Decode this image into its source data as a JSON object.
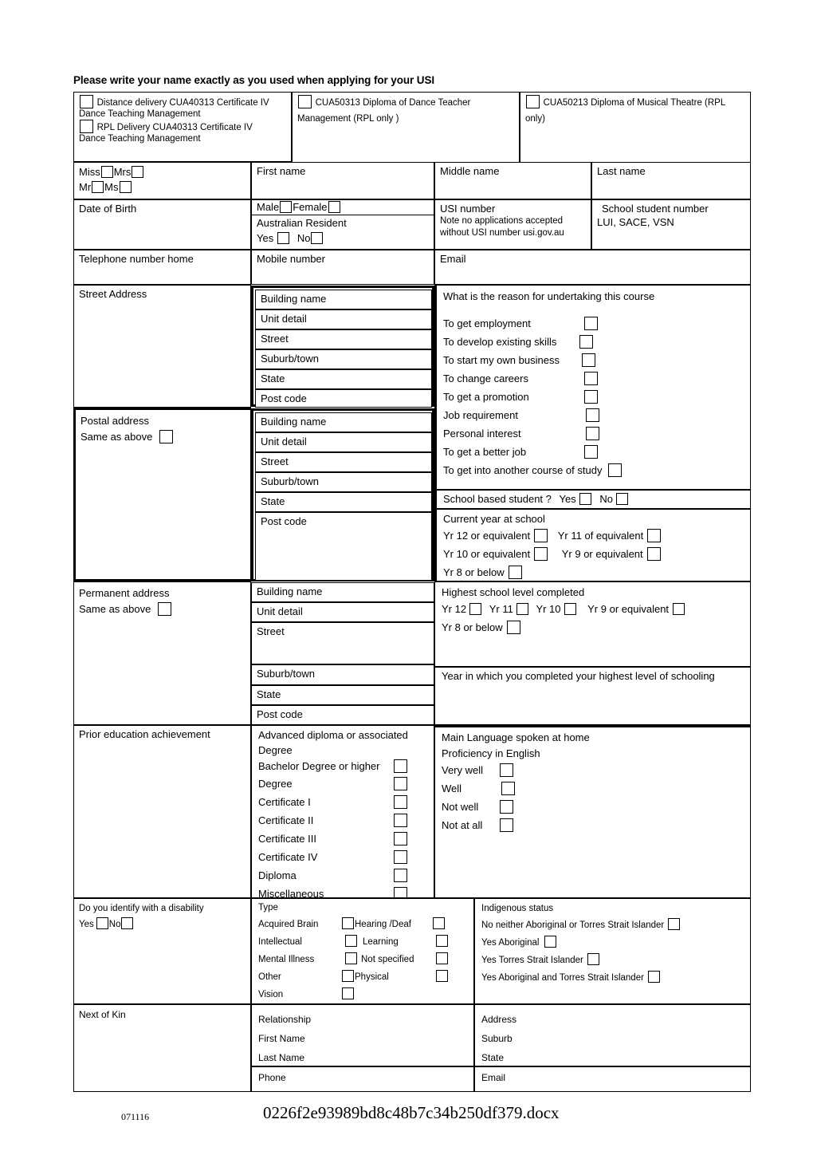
{
  "title": "Please write your name exactly as you used when applying for your USI",
  "courses": [
    {
      "id": "distance",
      "line1": "Distance delivery CUA40313 Certificate IV",
      "line2": "Dance Teaching Management"
    },
    {
      "id": "rpl",
      "line1": "RPL Delivery CUA40313 Certificate IV",
      "line2": "Dance Teaching Management"
    },
    {
      "id": "dance_teacher",
      "line1": "CUA50313 Diploma of Dance Teacher",
      "line2": "Management (RPL only )"
    },
    {
      "id": "musical_theatre",
      "line1": "CUA50213 Diploma of Musical Theatre  (RPL",
      "line2": "only)"
    }
  ],
  "titles": [
    "Miss",
    "Mrs",
    "Mr",
    "Ms"
  ],
  "name_fields": {
    "first": "First name",
    "middle": "Middle name",
    "last": "Last name"
  },
  "dob_label": "Date of Birth",
  "gender": {
    "male": "Male",
    "female": "Female"
  },
  "residency": {
    "label": "Australian Resident",
    "yes": "Yes",
    "no": "No"
  },
  "usi": {
    "label": "USI number",
    "note_line1": "Note no applications accepted",
    "note_line2": "without USI number usi.gov.au"
  },
  "school_student": {
    "line1": "School student number",
    "line2": "LUI, SACE, VSN"
  },
  "contact": {
    "telephone": "Telephone number home",
    "mobile": "Mobile number",
    "email": "Email"
  },
  "street_address": {
    "label": "Street Address",
    "fields": [
      "Building name",
      "Unit detail",
      "Street",
      "Suburb/town",
      "State",
      "Post code"
    ]
  },
  "postal_address": {
    "label": "Postal address",
    "same_as_above": "Same as above",
    "fields": [
      "Building name",
      "Unit detail",
      "Street",
      "Suburb/town",
      "State",
      "Post code"
    ]
  },
  "permanent_address": {
    "label": "Permanent address",
    "same_as_above": "Same as above",
    "fields": [
      "Building name",
      "Unit detail",
      "Street",
      "Suburb/town",
      "State",
      "Post code"
    ]
  },
  "reason": {
    "heading": "What is the reason for undertaking this course",
    "options": [
      "To get employment",
      "To develop existing skills",
      "To start my own business",
      "To change careers",
      "To get a promotion",
      "Job requirement",
      "Personal interest",
      "To get a better job",
      "To get into another course of study"
    ]
  },
  "school_based": {
    "label": "School based student ?",
    "yes": "Yes",
    "no": "No"
  },
  "current_year": {
    "heading": "Current year at school",
    "options": [
      "Yr 12 or equivalent",
      "Yr 11 of equivalent",
      "Yr 10 or equivalent",
      "Yr 9 or equivalent",
      "Yr 8 or below"
    ]
  },
  "highest_school": {
    "heading": "Highest school level completed",
    "options": [
      "Yr 12",
      "Yr 11",
      "Yr 10",
      "Yr 9 or equivalent",
      "Yr 8 or below"
    ]
  },
  "year_completed": "Year in which you completed your highest level of schooling",
  "prior_education": {
    "label": "Prior education achievement",
    "header_line1": "Advanced  diploma or associated",
    "header_line2": "Degree",
    "options": [
      "Bachelor Degree or higher",
      "Degree",
      "Certificate I",
      "Certificate II",
      "Certificate III",
      "Certificate IV",
      "Diploma",
      "Miscellaneous"
    ]
  },
  "language": {
    "heading1": "Main Language spoken at home",
    "heading2": "Proficiency in English",
    "options": [
      "Very well",
      "Well",
      "Not well",
      "Not at all"
    ]
  },
  "disability": {
    "question": "Do you identify with a disability",
    "yes": "Yes",
    "no": "No",
    "type_heading": "Type",
    "left_options": [
      "Acquired Brain",
      "Intellectual",
      "Mental Illness",
      "Other",
      "Vision"
    ],
    "right_options": [
      "Hearing /Deaf",
      "Learning",
      "Not specified",
      "Physical"
    ]
  },
  "indigenous": {
    "heading": "Indigenous status",
    "options": [
      "No neither Aboriginal or Torres Strait Islander",
      "Yes Aboriginal",
      "Yes Torres Strait Islander",
      "Yes Aboriginal and Torres Strait Islander"
    ]
  },
  "next_of_kin": {
    "label": "Next of Kin",
    "left": [
      "Relationship",
      "First Name",
      "Last Name"
    ],
    "right": [
      "Address",
      "Suburb",
      "State"
    ],
    "phone": "Phone",
    "email": "Email"
  },
  "footer": {
    "number": "071116",
    "filename": "0226f2e93989bd8c48b7c34b250df379.docx"
  }
}
